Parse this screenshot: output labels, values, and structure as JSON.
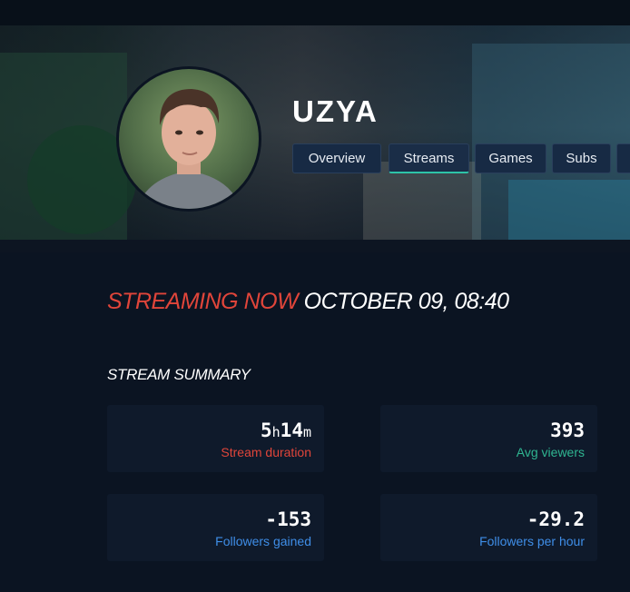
{
  "channel": {
    "name": "UZYA"
  },
  "tabs": [
    {
      "label": "Overview"
    },
    {
      "label": "Streams"
    },
    {
      "label": "Games"
    },
    {
      "label": "Subs"
    }
  ],
  "active_tab": "Streams",
  "stream": {
    "status": "STREAMING NOW",
    "date": "OCTOBER 09, 08:40"
  },
  "summary": {
    "title": "STREAM SUMMARY",
    "duration": {
      "hours": "5",
      "hours_unit": "h",
      "minutes": "14",
      "minutes_unit": "m",
      "label": "Stream duration"
    },
    "avg_viewers": {
      "value": "393",
      "label": "Avg viewers"
    },
    "followers_gained": {
      "value": "-153",
      "label": "Followers gained"
    },
    "followers_per_hour": {
      "value": "-29.2",
      "label": "Followers per hour"
    }
  },
  "colors": {
    "accent_red": "#e0453a",
    "accent_teal": "#2fb591",
    "accent_blue": "#3f8ee8",
    "tab_active_underline": "#2ec4a8",
    "background": "#0b1422"
  }
}
